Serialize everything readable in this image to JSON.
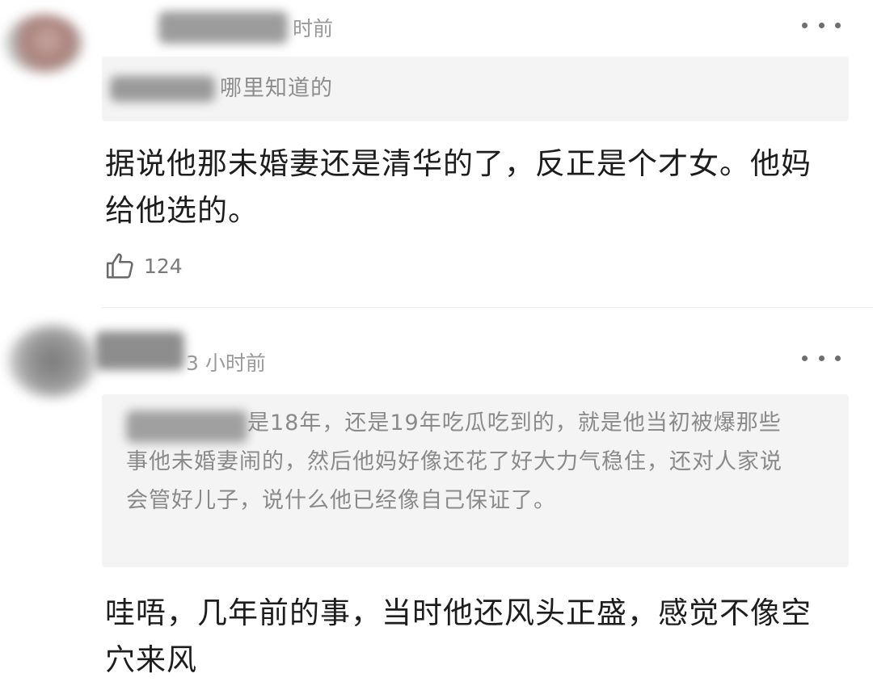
{
  "comments": [
    {
      "time_text": "时前",
      "quote": {
        "text": "哪里知道的"
      },
      "text": "据说他那未婚妻还是清华的了，反正是个才女。他妈给他选的。",
      "like_count": "124",
      "more_icon": "more-horizontal-icon",
      "like_icon": "thumbs-up-icon"
    },
    {
      "time_text": "3 小时前",
      "quote": {
        "text": "是18年，还是19年吃瓜吃到的，就是他当初被爆那些事他未婚妻闹的，然后他妈好像还花了好大力气稳住，还对人家说会管好儿子，说什么他已经像自己保证了。"
      },
      "text": "哇唔，几年前的事，当时他还风头正盛，感觉不像空穴来风",
      "more_icon": "more-horizontal-icon"
    }
  ],
  "colors": {
    "background": "#ffffff",
    "quote_background": "#f4f4f4",
    "meta_text": "#9a9a9a",
    "quote_text": "#8a8a8a",
    "body_text": "#1d1d1d"
  }
}
